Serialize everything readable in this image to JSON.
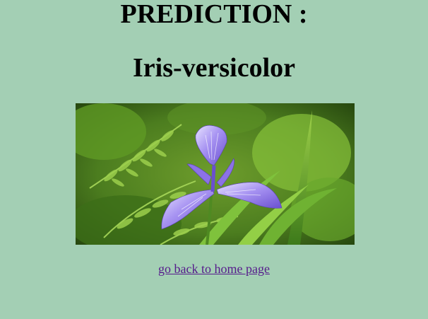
{
  "result": {
    "heading": "PREDICTION :",
    "species": "Iris-versicolor"
  },
  "image": {
    "subject": "iris-versicolor-flower",
    "colors": {
      "background": "#a3cfb4",
      "foliage_dark": "#2f5a14",
      "foliage_light": "#8cc63a",
      "petal": "#8a6fe0"
    }
  },
  "nav": {
    "home_link": "go back to home page"
  }
}
